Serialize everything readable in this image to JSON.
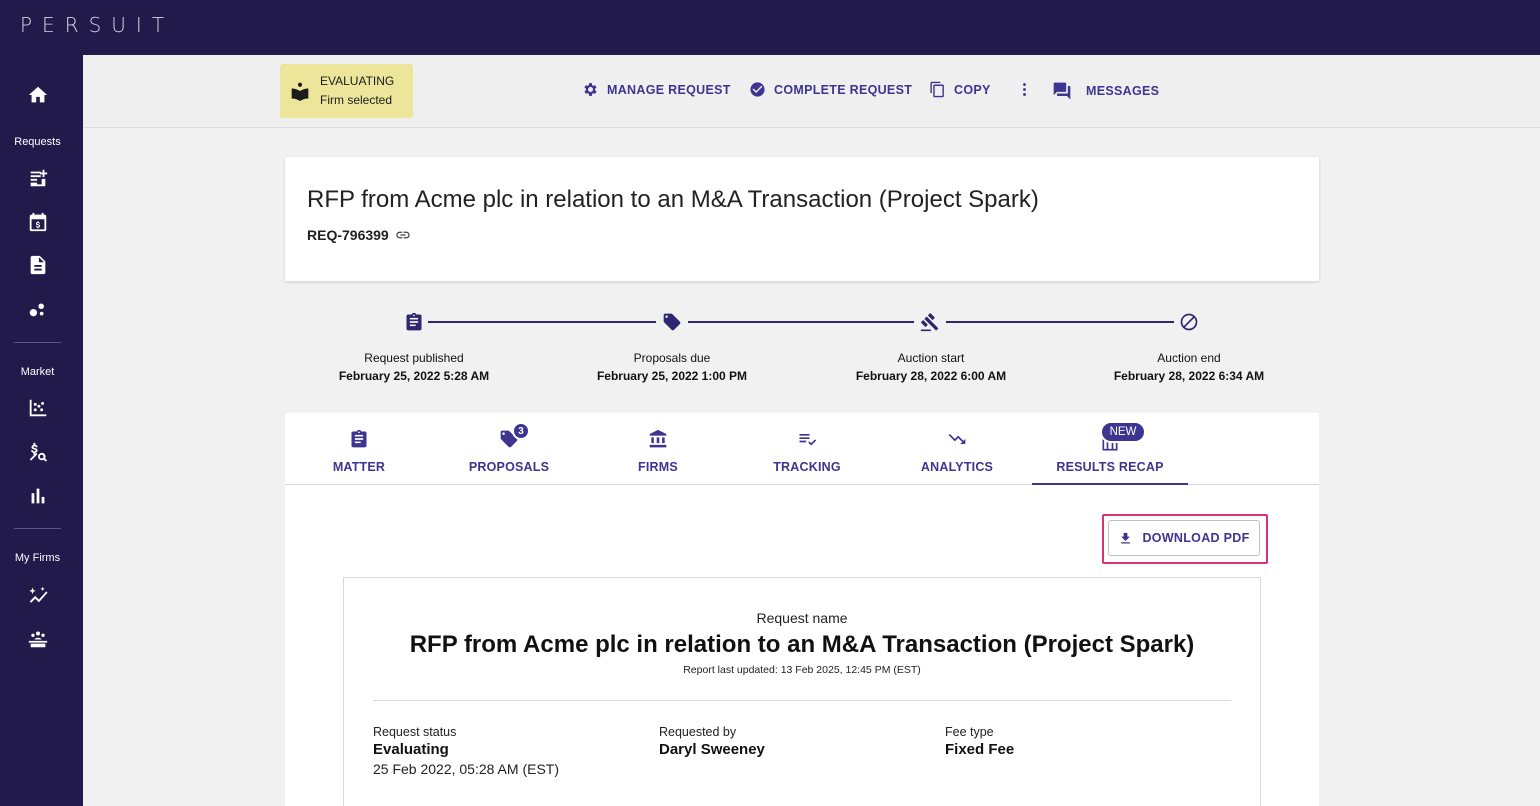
{
  "brand": {
    "logo_text": "PERSUIT"
  },
  "sidebar": {
    "items": [
      {
        "icon": "home-icon"
      },
      {
        "section": "Requests"
      },
      {
        "icon": "new-request-icon"
      },
      {
        "icon": "calendar-dollar-icon"
      },
      {
        "icon": "document-icon"
      },
      {
        "icon": "bubbles-icon"
      },
      {
        "section": "Market"
      },
      {
        "icon": "scatter-chart-icon"
      },
      {
        "icon": "price-search-icon"
      },
      {
        "icon": "bar-chart-icon"
      },
      {
        "section": "My Firms"
      },
      {
        "icon": "sparkle-chart-icon"
      },
      {
        "icon": "team-icon"
      }
    ],
    "sections": {
      "requests": "Requests",
      "market": "Market",
      "my_firms": "My Firms"
    }
  },
  "status": {
    "line1": "EVALUATING",
    "line2": "Firm selected",
    "color": "#ece59a"
  },
  "actions": {
    "manage": "MANAGE REQUEST",
    "complete": "COMPLETE REQUEST",
    "copy": "COPY",
    "messages": "MESSAGES"
  },
  "request": {
    "title": "RFP from Acme plc in relation to an M&A Transaction (Project Spark)",
    "id": "REQ-796399"
  },
  "timeline": [
    {
      "label": "Request published",
      "date": "February 25, 2022 5:28 AM",
      "icon": "clipboard-icon"
    },
    {
      "label": "Proposals due",
      "date": "February 25, 2022 1:00 PM",
      "icon": "tag-icon"
    },
    {
      "label": "Auction start",
      "date": "February 28, 2022 6:00 AM",
      "icon": "gavel-icon"
    },
    {
      "label": "Auction end",
      "date": "February 28, 2022 6:34 AM",
      "icon": "block-icon"
    }
  ],
  "tabs": [
    {
      "label": "MATTER",
      "icon": "clipboard-icon"
    },
    {
      "label": "PROPOSALS",
      "icon": "tag-icon",
      "badge": "3"
    },
    {
      "label": "FIRMS",
      "icon": "bank-icon"
    },
    {
      "label": "TRACKING",
      "icon": "checklist-icon"
    },
    {
      "label": "ANALYTICS",
      "icon": "trend-down-icon"
    },
    {
      "label": "RESULTS RECAP",
      "icon": "table-chart-icon",
      "pill": "NEW",
      "active": true
    }
  ],
  "download": {
    "label": "DOWNLOAD PDF"
  },
  "report": {
    "name_label": "Request name",
    "title": "RFP from Acme plc in relation to an M&A Transaction (Project Spark)",
    "updated": "Report last updated: 13 Feb 2025, 12:45 PM (EST)",
    "fields": {
      "status_label": "Request status",
      "status_value": "Evaluating",
      "status_sub": "25 Feb 2022, 05:28 AM (EST)",
      "by_label": "Requested by",
      "by_value": "Daryl Sweeney",
      "fee_label": "Fee type",
      "fee_value": "Fixed Fee"
    }
  },
  "colors": {
    "nav": "#211a4a",
    "accent": "#3d3590",
    "highlight": "#d6337c"
  }
}
